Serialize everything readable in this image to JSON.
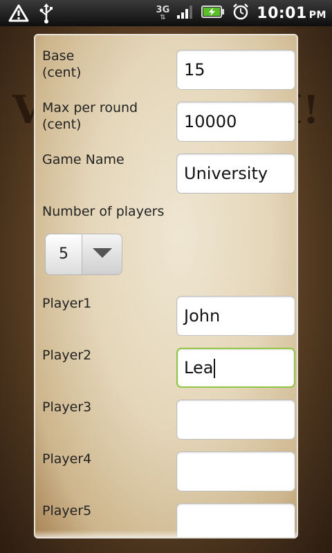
{
  "status_bar": {
    "network": "3G",
    "time": "10:01",
    "ampm": "PM",
    "icons": [
      "warning-icon",
      "usb-icon",
      "signal-icon",
      "battery-charging-icon",
      "alarm-clock-icon"
    ]
  },
  "dialog": {
    "base": {
      "label": "Base\n(cent)",
      "value": "15"
    },
    "max_per_round": {
      "label": "Max per round\n(cent)",
      "value": "10000"
    },
    "game_name": {
      "label": "Game Name",
      "value": "University"
    },
    "number_of_players": {
      "label": "Number of players",
      "selected": "5"
    },
    "players": [
      {
        "label": "Player1",
        "value": "John"
      },
      {
        "label": "Player2",
        "value": "Lea"
      },
      {
        "label": "Player3",
        "value": ""
      },
      {
        "label": "Player4",
        "value": ""
      },
      {
        "label": "Player5",
        "value": ""
      }
    ]
  },
  "colors": {
    "focus_border": "#8ec63f",
    "dialog_border": "#e8e4dc"
  }
}
